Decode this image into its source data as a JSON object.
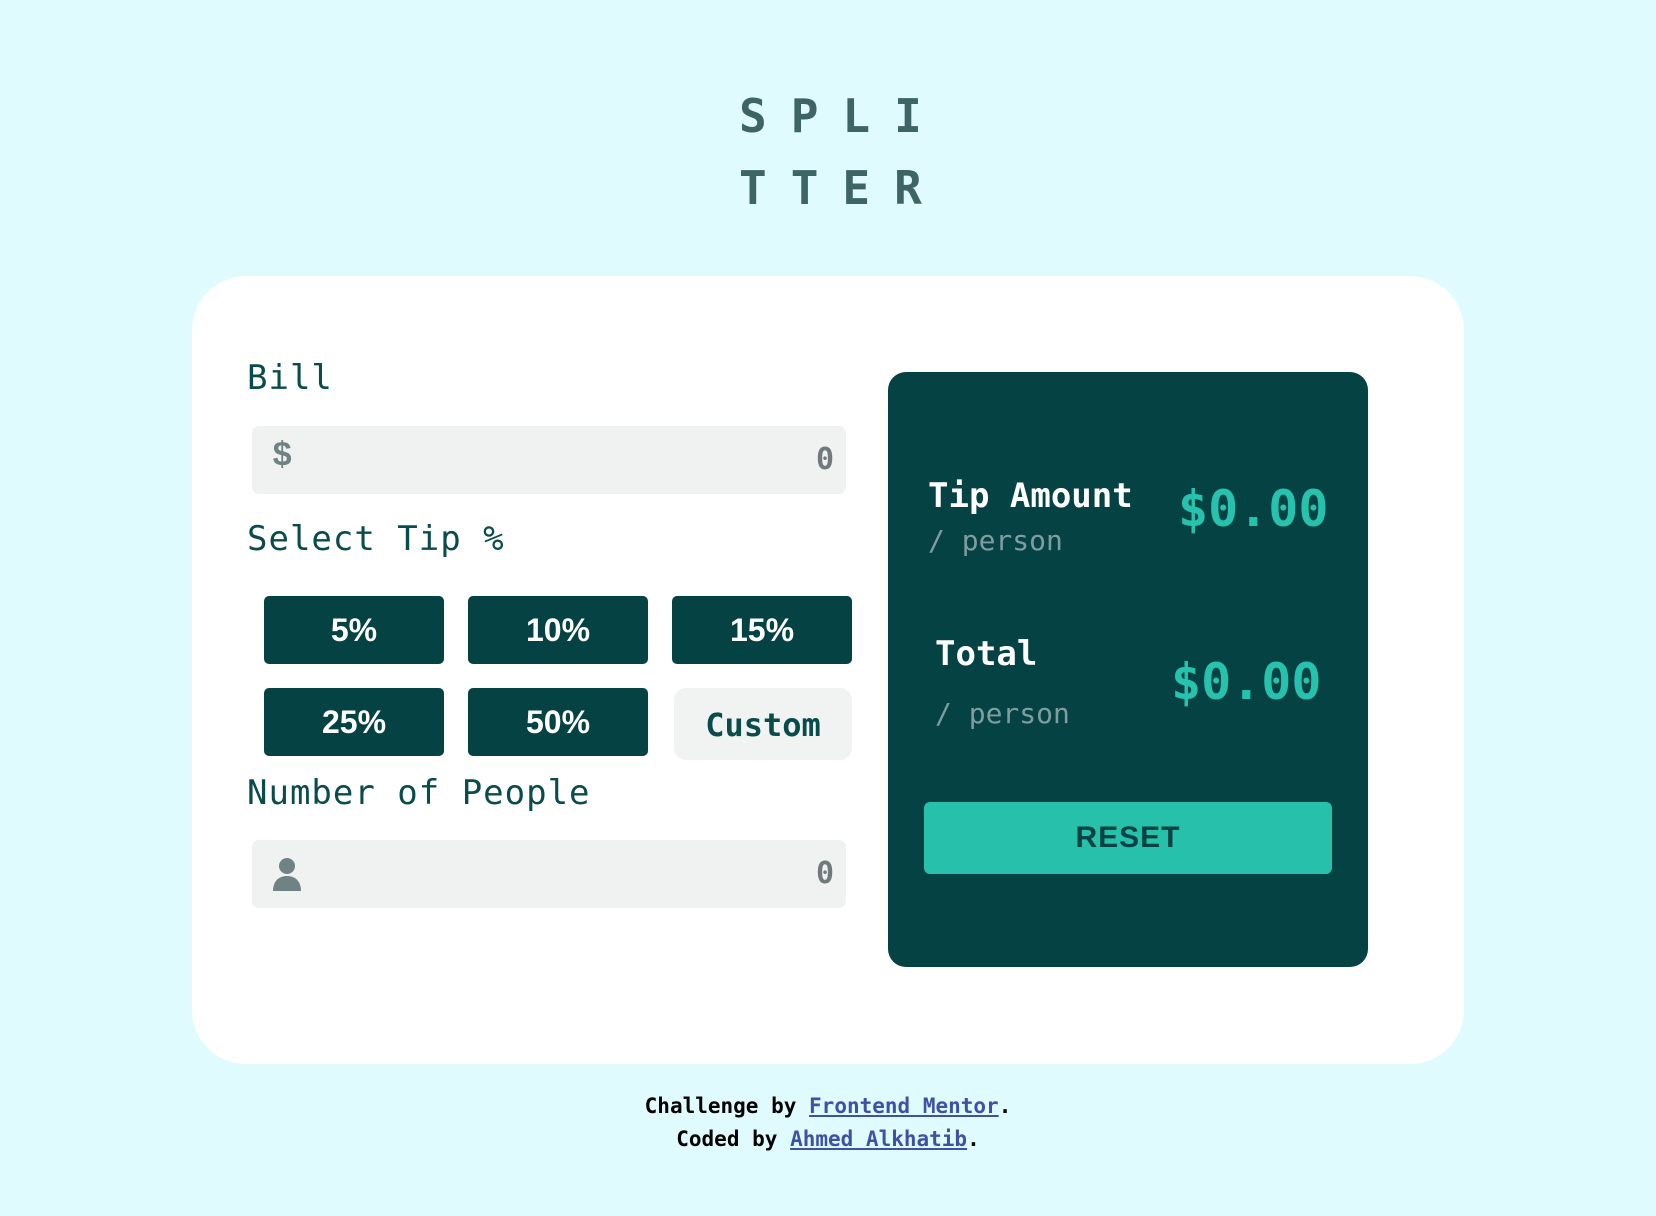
{
  "logo": {
    "line1": "SPLI",
    "line2": "TTER"
  },
  "bill": {
    "label": "Bill",
    "prefix_symbol": "$",
    "value": "0"
  },
  "tip": {
    "label": "Select Tip %",
    "options": [
      "5%",
      "10%",
      "15%",
      "25%",
      "50%"
    ],
    "custom_label": "Custom"
  },
  "people": {
    "label": "Number of People",
    "icon": "person-icon",
    "value": "0"
  },
  "results": {
    "tip_amount": {
      "title": "Tip Amount",
      "sub": "/ person",
      "value": "$0.00"
    },
    "total": {
      "title": "Total",
      "sub": "/ person",
      "value": "$0.00"
    },
    "reset_label": "RESET"
  },
  "footer": {
    "line1_prefix": "Challenge by",
    "line1_link": "Frontend Mentor",
    "line1_suffix": ".",
    "line2_prefix": "Coded by",
    "line2_link": "Ahmed Alkhatib",
    "line2_suffix": "."
  },
  "colors": {
    "background": "#e0fbfe",
    "dark_teal": "#054244",
    "accent": "#26c2ad",
    "input_bg": "#f0f2f1",
    "link": "#3e52a3"
  }
}
